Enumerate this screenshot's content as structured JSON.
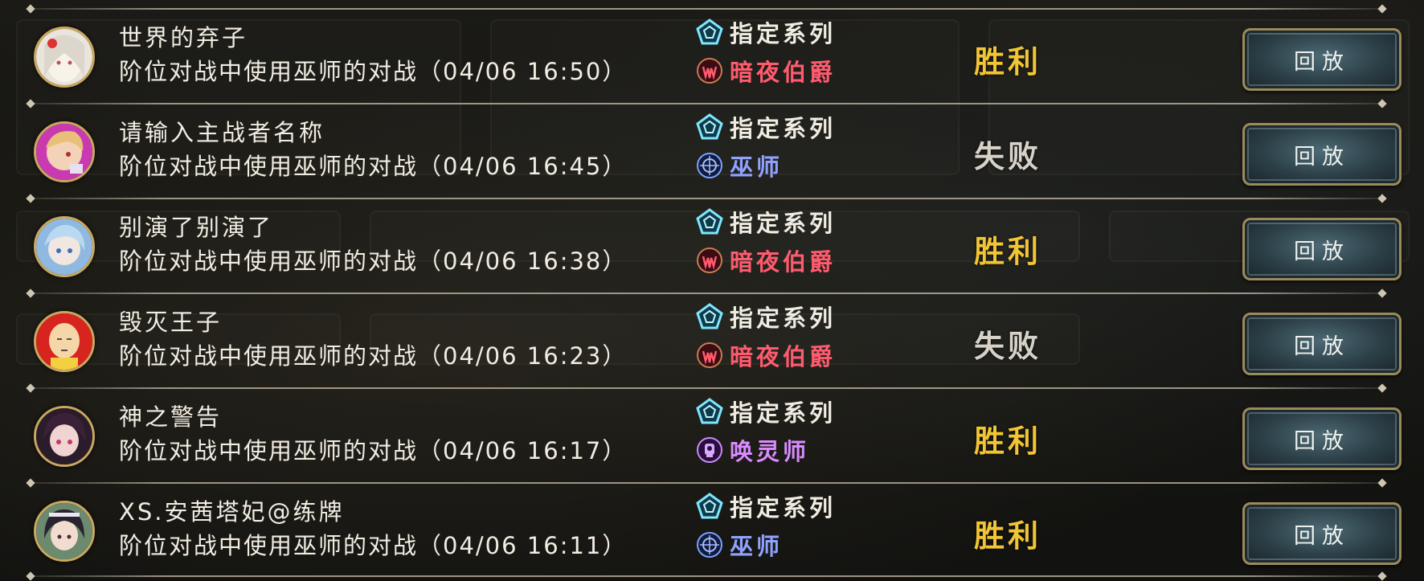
{
  "icons": {
    "specified": "pentagon-gem-icon",
    "nightcount": "night-count-crest-icon",
    "mage": "mage-rune-icon",
    "summoner": "summoner-lantern-icon"
  },
  "colors": {
    "win": "#f1c533",
    "lose": "#d7d2c8",
    "nightcount": "#ff5b6e",
    "mage": "#8fa2ff",
    "summoner": "#d98bff"
  },
  "rows": [
    {
      "name": "世界的弃子",
      "desc": "阶位对战中使用巫师的对战（04/06 16:50）",
      "tag1": "指定系列",
      "tag2": "暗夜伯爵",
      "result": "胜利",
      "button": "回放"
    },
    {
      "name": "请输入主战者名称",
      "desc": "阶位对战中使用巫师的对战（04/06 16:45）",
      "tag1": "指定系列",
      "tag2": "巫师",
      "result": "失败",
      "button": "回放"
    },
    {
      "name": "别演了别演了",
      "desc": "阶位对战中使用巫师的对战（04/06 16:38）",
      "tag1": "指定系列",
      "tag2": "暗夜伯爵",
      "result": "胜利",
      "button": "回放"
    },
    {
      "name": "毁灭王子",
      "desc": "阶位对战中使用巫师的对战（04/06 16:23）",
      "tag1": "指定系列",
      "tag2": "暗夜伯爵",
      "result": "失败",
      "button": "回放"
    },
    {
      "name": "神之警告",
      "desc": "阶位对战中使用巫师的对战（04/06 16:17）",
      "tag1": "指定系列",
      "tag2": "唤灵师",
      "result": "胜利",
      "button": "回放"
    },
    {
      "name": "XS.安茜塔妃@练牌",
      "desc": "阶位对战中使用巫师的对战（04/06 16:11）",
      "tag1": "指定系列",
      "tag2": "巫师",
      "result": "胜利",
      "button": "回放"
    }
  ]
}
